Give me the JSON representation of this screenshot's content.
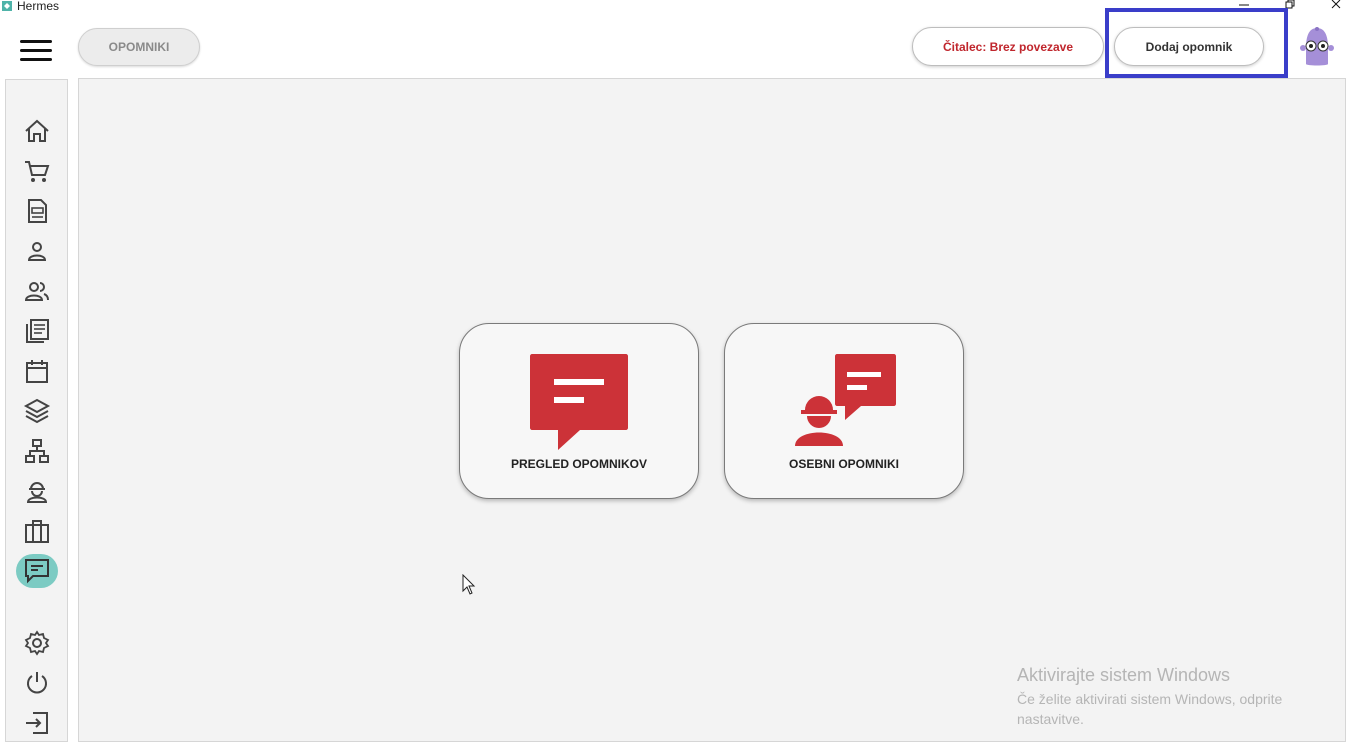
{
  "window": {
    "title": "Hermes"
  },
  "header": {
    "section_label": "OPOMNIKI",
    "reader_status": "Čitalec: Brez povezave",
    "add_button": "Dodaj opomnik"
  },
  "sidebar": {
    "items": [
      {
        "icon": "home-icon"
      },
      {
        "icon": "cart-icon"
      },
      {
        "icon": "document-icon"
      },
      {
        "icon": "user-icon"
      },
      {
        "icon": "users-icon"
      },
      {
        "icon": "articles-icon"
      },
      {
        "icon": "calendar-icon"
      },
      {
        "icon": "layers-icon"
      },
      {
        "icon": "network-icon"
      },
      {
        "icon": "worker-icon"
      },
      {
        "icon": "briefcase-icon"
      },
      {
        "icon": "reminder-icon",
        "active": true
      },
      {
        "icon": "settings-icon"
      },
      {
        "icon": "power-icon"
      },
      {
        "icon": "logout-icon"
      }
    ]
  },
  "cards": [
    {
      "label": "PREGLED OPOMNIKOV",
      "icon": "speech-bubble-icon"
    },
    {
      "label": "OSEBNI OPOMNIKI",
      "icon": "worker-speech-icon"
    }
  ],
  "watermark": {
    "title": "Aktivirajte sistem Windows",
    "subtitle": "Če želite aktivirati sistem Windows, odprite nastavitve."
  },
  "colors": {
    "accent_red": "#cc3238",
    "active_teal": "#7ccbc3",
    "highlight_blue": "#3a3ec9"
  }
}
